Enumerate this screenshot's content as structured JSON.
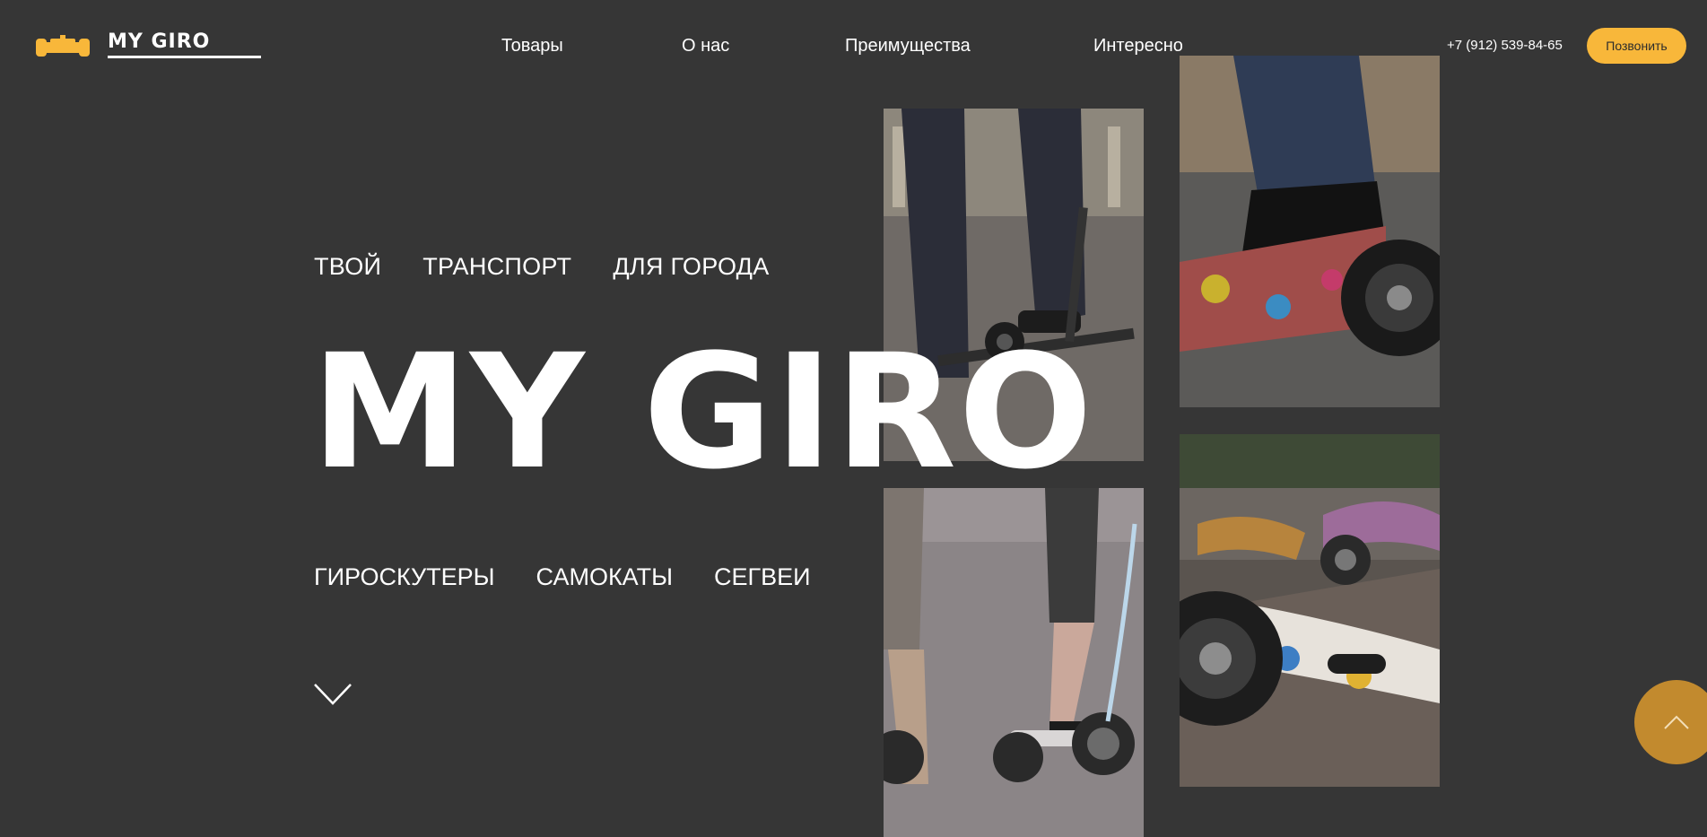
{
  "header": {
    "logo_text": "MY GIRO",
    "nav": [
      {
        "label": "Товары"
      },
      {
        "label": "О нас"
      },
      {
        "label": "Преимущества"
      },
      {
        "label": "Интересно"
      }
    ],
    "phone": "+7 (912) 539-84-65",
    "call_button": "Позвонить"
  },
  "hero": {
    "tagline": [
      "ТВОЙ",
      "ТРАНСПОРТ",
      "ДЛЯ ГОРОДА"
    ],
    "title": "MY GIRO",
    "categories": [
      "ГИРОСКУТЕРЫ",
      "САМОКАТЫ",
      "СЕГВЕИ"
    ]
  },
  "colors": {
    "background": "#363636",
    "accent": "#f8b73a",
    "accent_dark": "#c28a2e",
    "text": "#ffffff"
  },
  "icons": {
    "logo": "hoverboard-icon",
    "scroll_down": "chevron-down-icon",
    "to_top": "chevron-up-icon"
  }
}
